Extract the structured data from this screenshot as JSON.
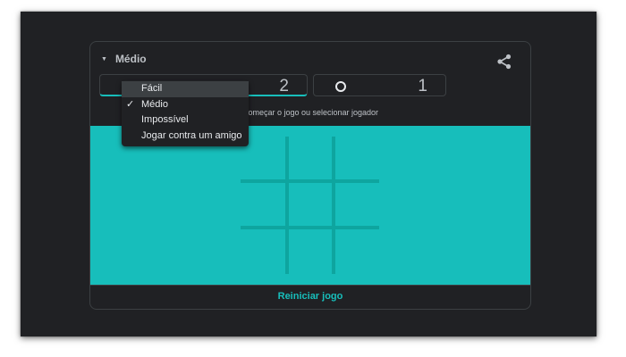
{
  "difficulty": {
    "selected_label": "Médio",
    "options": [
      {
        "label": "Fácil",
        "checked": false,
        "hovered": true
      },
      {
        "label": "Médio",
        "checked": true,
        "hovered": false
      },
      {
        "label": "Impossível",
        "checked": false,
        "hovered": false
      },
      {
        "label": "Jogar contra um amigo",
        "checked": false,
        "hovered": false
      }
    ]
  },
  "scores": {
    "x_score": "2",
    "o_score": "1"
  },
  "hint": "Começar o jogo ou selecionar jogador",
  "restart_label": "Reiniciar jogo",
  "colors": {
    "board": "#17bebb",
    "grid_line": "#0ea59f",
    "background": "#202124",
    "accent": "#17bebb"
  },
  "icons": {
    "share": "share-icon",
    "dropdown": "caret-down-icon",
    "check": "check-icon",
    "o_player": "o-mark-icon"
  }
}
